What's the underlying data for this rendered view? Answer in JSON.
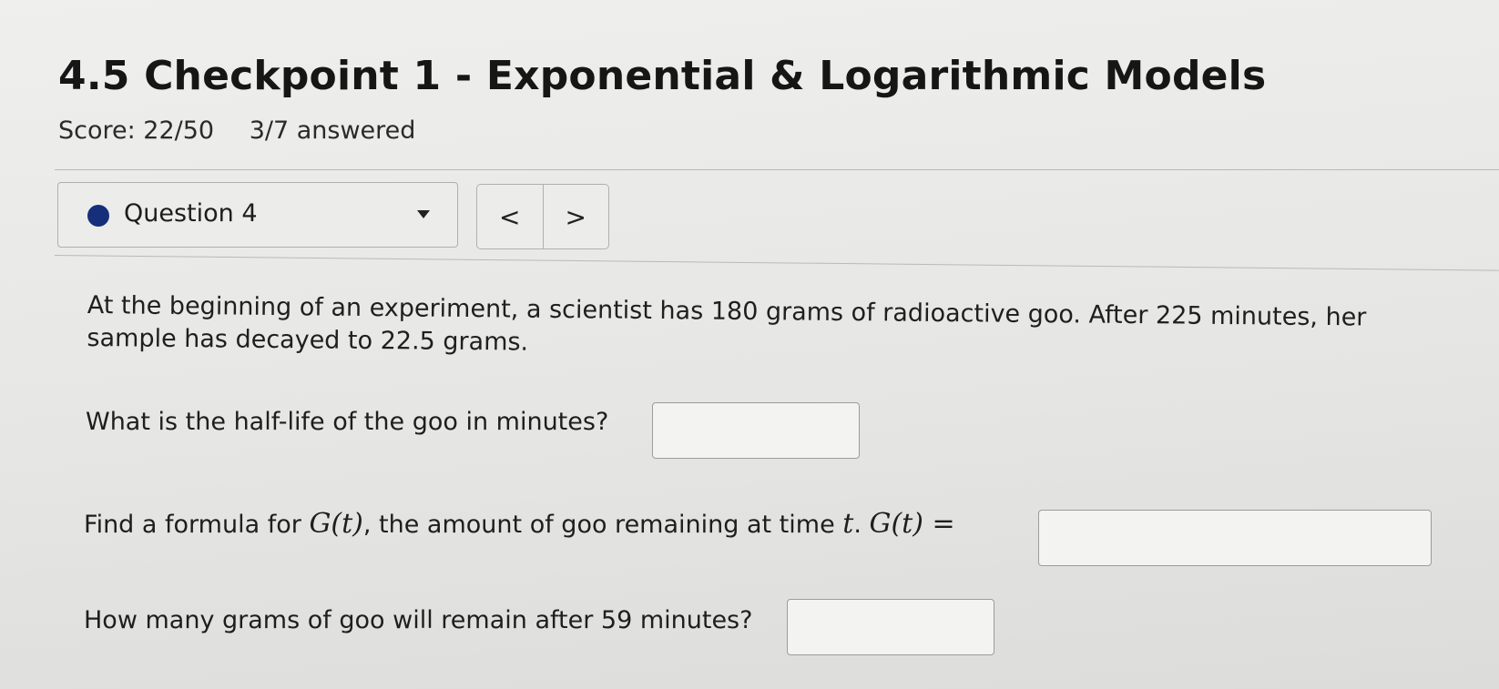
{
  "header": {
    "title": "4.5 Checkpoint 1 - Exponential & Logarithmic Models",
    "score": "Score: 22/50",
    "answered": "3/7 answered"
  },
  "question_nav": {
    "selected": "Question 4",
    "prev_label": "<",
    "next_label": ">",
    "status_color": "#162f7a"
  },
  "question": {
    "intro": "At the beginning of an experiment, a scientist has 180 grams of radioactive goo. After 225 minutes, her sample has decayed to 22.5 grams.",
    "part1": {
      "prompt": "What is the half-life of the goo in minutes?",
      "value": ""
    },
    "part2": {
      "prompt_pre": "Find a formula for ",
      "func": "G(t)",
      "prompt_mid": ", the amount of goo remaining at time ",
      "var": "t",
      "prompt_end": ". ",
      "lhs": "G(t) =",
      "value": ""
    },
    "part3": {
      "prompt": "How many grams of goo will remain after 59 minutes?",
      "value": ""
    }
  }
}
